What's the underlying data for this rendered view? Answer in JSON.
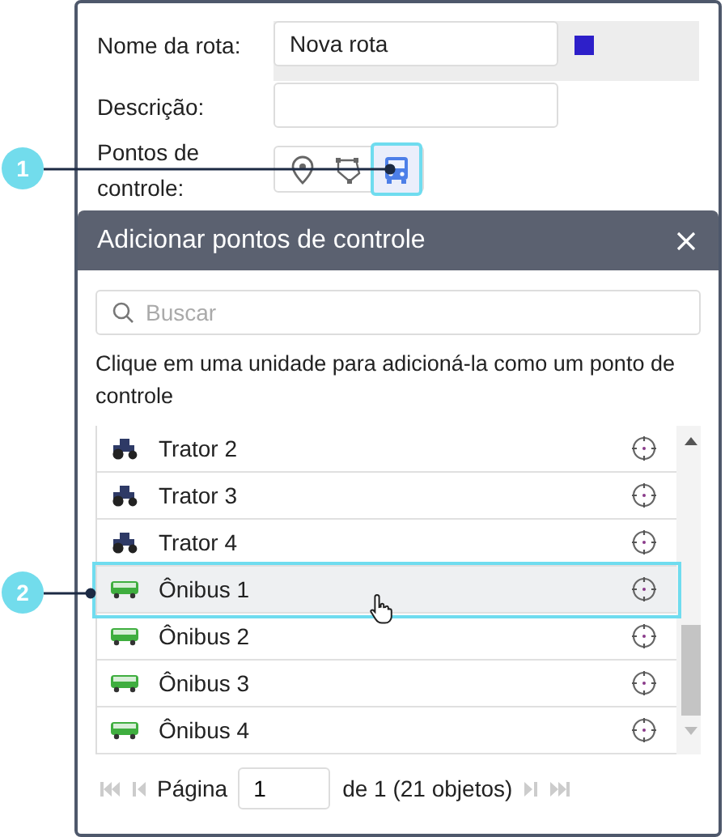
{
  "route_form": {
    "name_label": "Nome da rota:",
    "name_value": "Nova rota",
    "color": "#2d1fc9",
    "description_label": "Descrição:",
    "checkpoints_label": "Pontos de controle:",
    "checkpoint_buttons": [
      {
        "kind": "marker",
        "selected": false
      },
      {
        "kind": "geofence",
        "selected": false
      },
      {
        "kind": "unit",
        "selected": true
      }
    ]
  },
  "dialog": {
    "title": "Adicionar pontos de controle",
    "search": {
      "placeholder": "Buscar"
    },
    "hint": "Clique em uma unidade para adicioná-la como um ponto de controle",
    "units": [
      {
        "name": "Trator 2",
        "kind": "tractor",
        "selected": false
      },
      {
        "name": "Trator 3",
        "kind": "tractor",
        "selected": false
      },
      {
        "name": "Trator 4",
        "kind": "tractor",
        "selected": false
      },
      {
        "name": "Ônibus 1",
        "kind": "bus",
        "selected": true
      },
      {
        "name": "Ônibus 2",
        "kind": "bus",
        "selected": false
      },
      {
        "name": "Ônibus 3",
        "kind": "bus",
        "selected": false
      },
      {
        "name": "Ônibus 4",
        "kind": "bus",
        "selected": false
      }
    ],
    "pagination": {
      "page_label": "Página",
      "page_value": "1",
      "total": "de 1 (21 objetos)"
    }
  },
  "callouts": [
    {
      "number": "1"
    },
    {
      "number": "2"
    }
  ]
}
